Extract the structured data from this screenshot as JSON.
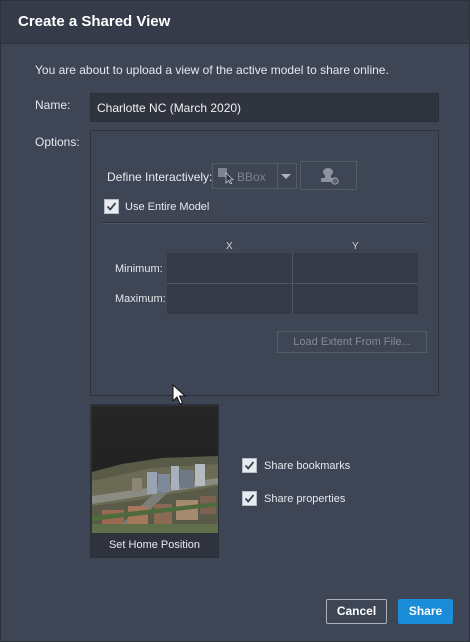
{
  "dialog": {
    "title": "Create a Shared View",
    "intro": "You are about to upload a view of the active model to share online.",
    "name_label": "Name:",
    "name_value": "Charlotte NC (March 2020)",
    "options_label": "Options:"
  },
  "options": {
    "define_label": "Define Interactively:",
    "define_value": "BBox",
    "use_entire_model_label": "Use Entire Model",
    "use_entire_model_checked": true,
    "col_x": "X",
    "col_y": "Y",
    "row_min": "Minimum:",
    "row_max": "Maximum:",
    "load_extent_label": "Load Extent From File..."
  },
  "thumbnail": {
    "caption": "Set Home Position"
  },
  "share_options": {
    "bookmarks_label": "Share bookmarks",
    "bookmarks_checked": true,
    "properties_label": "Share properties",
    "properties_checked": true
  },
  "buttons": {
    "cancel": "Cancel",
    "share": "Share"
  },
  "colors": {
    "background": "#3e4554",
    "titlebar": "#353b48",
    "accent": "#1a8cd8"
  }
}
